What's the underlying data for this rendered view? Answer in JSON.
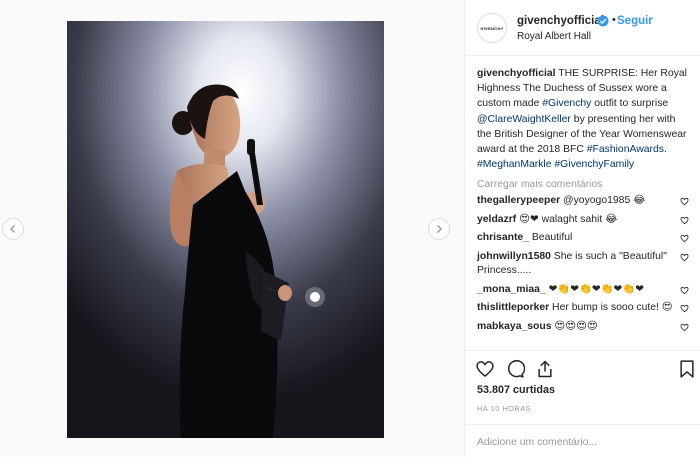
{
  "post": {
    "username": "givenchyofficial",
    "follow_label": "Seguir",
    "location": "Royal Albert Hall",
    "avatar_text": "GIVENCHY"
  },
  "caption": {
    "user": "givenchyofficial",
    "text_1": " THE SURPRISE: Her Royal Highness The Duchess of Sussex wore a custom made ",
    "link_1": "#Givenchy",
    "text_2": " outfit to surprise ",
    "link_2": "@ClareWaightKeller",
    "text_3": " by presenting her with the British Designer of the Year Womenswear award at the 2018 BFC ",
    "link_3": "#FashionAwards",
    "text_4": ". ",
    "link_4": "#MeghanMarkle",
    "text_5": " ",
    "link_5": "#GivenchyFamily"
  },
  "load_more_label": "Carregar mais comentários",
  "comments": [
    {
      "user": "thegallerypeeper",
      "text": " @yoyogo1985 😂"
    },
    {
      "user": "yeldazrf",
      "text": " 😍❤ walaght sahit 😂"
    },
    {
      "user": "chrisante_",
      "text": " Beautiful"
    },
    {
      "user": "johnwillyn1580",
      "text": " She is such a \"Beautiful\" Princess....."
    },
    {
      "user": "_mona_miaa_",
      "text": " ❤👏❤👏❤👏❤👏❤"
    },
    {
      "user": "thislittleporker",
      "text": " Her bump is sooo cute! 😍"
    },
    {
      "user": "mabkaya_sous",
      "text": " 😍😍😍😍"
    }
  ],
  "likes": "53.807 curtidas",
  "time": "HÁ 10 HORAS",
  "add_comment_placeholder": "Adicione um comentário...",
  "icons": {
    "heart": "heart-icon",
    "comment": "comment-icon",
    "share": "share-icon",
    "save": "bookmark-icon",
    "verified": "verified-badge-icon",
    "prev": "chevron-left-icon",
    "next": "chevron-right-icon"
  },
  "colors": {
    "link": "#003569",
    "follow": "#3897f0",
    "verified": "#3897f0",
    "muted": "#999999"
  }
}
